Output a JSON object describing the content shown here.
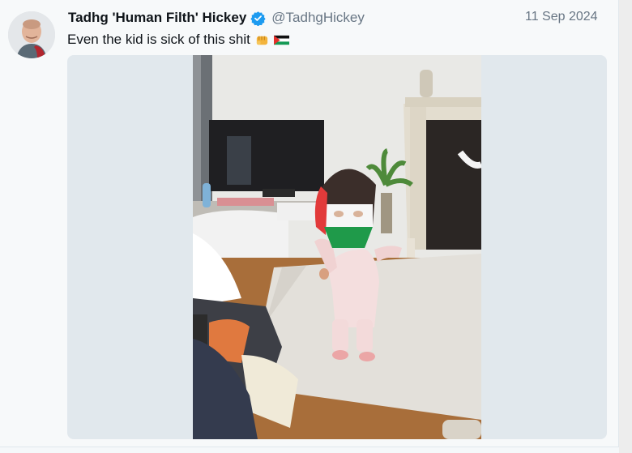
{
  "tweet": {
    "author": {
      "display_name": "Tadhg 'Human Filth' Hickey",
      "handle": "@TadhgHickey",
      "verified": true
    },
    "date": "11 Sep 2024",
    "text": "Even the kid is sick of this shit",
    "emojis": [
      "oncoming-fist",
      "palestine-flag"
    ]
  },
  "colors": {
    "verified_blue": "#1d9bf0",
    "muted_text": "#687684",
    "media_bg": "#e1e8ed"
  }
}
